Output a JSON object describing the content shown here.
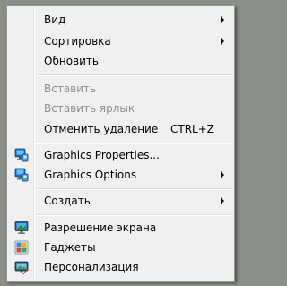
{
  "context_menu": {
    "view": {
      "label": "Вид"
    },
    "sort": {
      "label": "Сортировка"
    },
    "refresh": {
      "label": "Обновить"
    },
    "paste": {
      "label": "Вставить"
    },
    "paste_shortcut": {
      "label": "Вставить ярлык"
    },
    "undo_delete": {
      "label": "Отменить удаление",
      "shortcut": "CTRL+Z"
    },
    "graphics_properties": {
      "label": "Graphics Properties...",
      "icon": "intel-graphics-icon"
    },
    "graphics_options": {
      "label": "Graphics Options",
      "icon": "intel-graphics-icon"
    },
    "new": {
      "label": "Создать"
    },
    "screen_resolution": {
      "label": "Разрешение экрана",
      "icon": "monitor-icon"
    },
    "gadgets": {
      "label": "Гаджеты",
      "icon": "gadgets-icon"
    },
    "personalize": {
      "label": "Персонализация",
      "icon": "personalize-icon"
    }
  }
}
